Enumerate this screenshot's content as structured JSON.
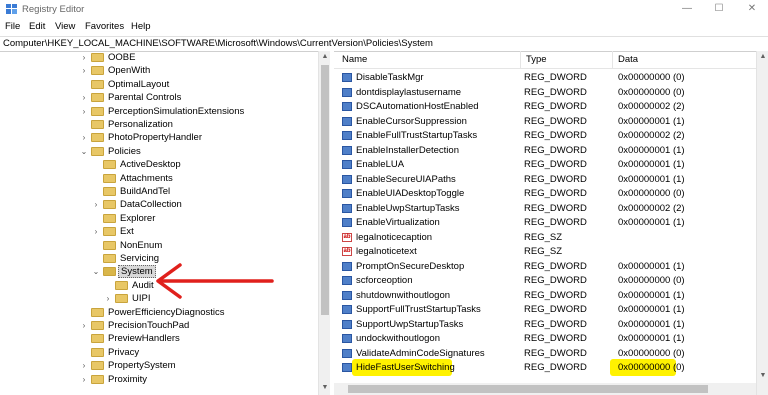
{
  "window": {
    "title": "Registry Editor",
    "minimize": "—",
    "maximize": "☐",
    "close": "✕"
  },
  "menu": [
    "File",
    "Edit",
    "View",
    "Favorites",
    "Help"
  ],
  "address": "Computer\\HKEY_LOCAL_MACHINE\\SOFTWARE\\Microsoft\\Windows\\CurrentVersion\\Policies\\System",
  "tree": [
    {
      "label": "OOBE",
      "indent": 0,
      "exp": "›"
    },
    {
      "label": "OpenWith",
      "indent": 0,
      "exp": "›"
    },
    {
      "label": "OptimalLayout",
      "indent": 0,
      "exp": ""
    },
    {
      "label": "Parental Controls",
      "indent": 0,
      "exp": "›"
    },
    {
      "label": "PerceptionSimulationExtensions",
      "indent": 0,
      "exp": "›"
    },
    {
      "label": "Personalization",
      "indent": 0,
      "exp": ""
    },
    {
      "label": "PhotoPropertyHandler",
      "indent": 0,
      "exp": "›"
    },
    {
      "label": "Policies",
      "indent": 0,
      "exp": "⌄"
    },
    {
      "label": "ActiveDesktop",
      "indent": 1,
      "exp": ""
    },
    {
      "label": "Attachments",
      "indent": 1,
      "exp": ""
    },
    {
      "label": "BuildAndTel",
      "indent": 1,
      "exp": ""
    },
    {
      "label": "DataCollection",
      "indent": 1,
      "exp": "›"
    },
    {
      "label": "Explorer",
      "indent": 1,
      "exp": ""
    },
    {
      "label": "Ext",
      "indent": 1,
      "exp": "›"
    },
    {
      "label": "NonEnum",
      "indent": 1,
      "exp": ""
    },
    {
      "label": "Servicing",
      "indent": 1,
      "exp": ""
    },
    {
      "label": "System",
      "indent": 1,
      "exp": "⌄",
      "selected": true
    },
    {
      "label": "Audit",
      "indent": 2,
      "exp": ""
    },
    {
      "label": "UIPI",
      "indent": 2,
      "exp": "›"
    },
    {
      "label": "PowerEfficiencyDiagnostics",
      "indent": 0,
      "exp": ""
    },
    {
      "label": "PrecisionTouchPad",
      "indent": 0,
      "exp": "›"
    },
    {
      "label": "PreviewHandlers",
      "indent": 0,
      "exp": ""
    },
    {
      "label": "Privacy",
      "indent": 0,
      "exp": ""
    },
    {
      "label": "PropertySystem",
      "indent": 0,
      "exp": "›"
    },
    {
      "label": "Proximity",
      "indent": 0,
      "exp": "›"
    }
  ],
  "columns": {
    "name": "Name",
    "type": "Type",
    "data": "Data"
  },
  "values": [
    {
      "name": "DisableTaskMgr",
      "type": "REG_DWORD",
      "data": "0x00000000 (0)",
      "kind": "dword"
    },
    {
      "name": "dontdisplaylastusername",
      "type": "REG_DWORD",
      "data": "0x00000000 (0)",
      "kind": "dword"
    },
    {
      "name": "DSCAutomationHostEnabled",
      "type": "REG_DWORD",
      "data": "0x00000002 (2)",
      "kind": "dword"
    },
    {
      "name": "EnableCursorSuppression",
      "type": "REG_DWORD",
      "data": "0x00000001 (1)",
      "kind": "dword"
    },
    {
      "name": "EnableFullTrustStartupTasks",
      "type": "REG_DWORD",
      "data": "0x00000002 (2)",
      "kind": "dword"
    },
    {
      "name": "EnableInstallerDetection",
      "type": "REG_DWORD",
      "data": "0x00000001 (1)",
      "kind": "dword"
    },
    {
      "name": "EnableLUA",
      "type": "REG_DWORD",
      "data": "0x00000001 (1)",
      "kind": "dword"
    },
    {
      "name": "EnableSecureUIAPaths",
      "type": "REG_DWORD",
      "data": "0x00000001 (1)",
      "kind": "dword"
    },
    {
      "name": "EnableUIADesktopToggle",
      "type": "REG_DWORD",
      "data": "0x00000000 (0)",
      "kind": "dword"
    },
    {
      "name": "EnableUwpStartupTasks",
      "type": "REG_DWORD",
      "data": "0x00000002 (2)",
      "kind": "dword"
    },
    {
      "name": "EnableVirtualization",
      "type": "REG_DWORD",
      "data": "0x00000001 (1)",
      "kind": "dword"
    },
    {
      "name": "legalnoticecaption",
      "type": "REG_SZ",
      "data": "",
      "kind": "sz"
    },
    {
      "name": "legalnoticetext",
      "type": "REG_SZ",
      "data": "",
      "kind": "sz"
    },
    {
      "name": "PromptOnSecureDesktop",
      "type": "REG_DWORD",
      "data": "0x00000001 (1)",
      "kind": "dword"
    },
    {
      "name": "scforceoption",
      "type": "REG_DWORD",
      "data": "0x00000000 (0)",
      "kind": "dword"
    },
    {
      "name": "shutdownwithoutlogon",
      "type": "REG_DWORD",
      "data": "0x00000001 (1)",
      "kind": "dword"
    },
    {
      "name": "SupportFullTrustStartupTasks",
      "type": "REG_DWORD",
      "data": "0x00000001 (1)",
      "kind": "dword"
    },
    {
      "name": "SupportUwpStartupTasks",
      "type": "REG_DWORD",
      "data": "0x00000001 (1)",
      "kind": "dword"
    },
    {
      "name": "undockwithoutlogon",
      "type": "REG_DWORD",
      "data": "0x00000001 (1)",
      "kind": "dword"
    },
    {
      "name": "ValidateAdminCodeSignatures",
      "type": "REG_DWORD",
      "data": "0x00000000 (0)",
      "kind": "dword"
    },
    {
      "name": "HideFastUserSwitching",
      "type": "REG_DWORD",
      "data": "0x00000000 (0)",
      "kind": "dword",
      "highlight": true
    }
  ],
  "colors": {
    "highlight": "#fff200",
    "arrow": "#e0201c",
    "folder": "#e8c766"
  }
}
